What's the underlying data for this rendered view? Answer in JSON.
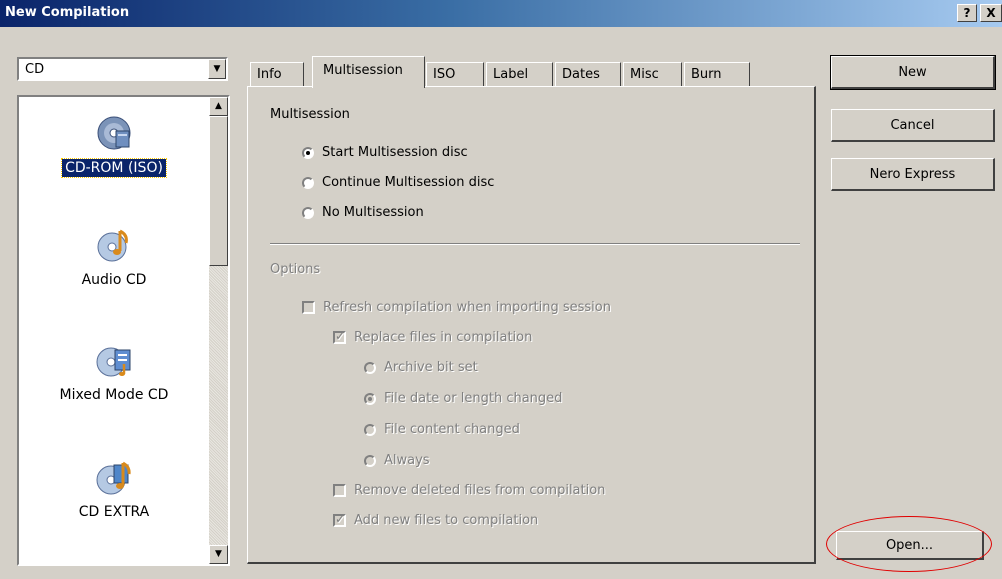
{
  "window": {
    "title": "New Compilation",
    "help_label": "?",
    "close_label": "X"
  },
  "disc_type": {
    "value": "CD"
  },
  "compilation_types": [
    {
      "label": "CD-ROM (ISO)",
      "icon": "cd-rom-iso-icon",
      "selected": true
    },
    {
      "label": "Audio CD",
      "icon": "audio-cd-icon",
      "selected": false
    },
    {
      "label": "Mixed Mode CD",
      "icon": "mixed-mode-cd-icon",
      "selected": false
    },
    {
      "label": "CD EXTRA",
      "icon": "cd-extra-icon",
      "selected": false
    }
  ],
  "tabs": [
    {
      "label": "Info",
      "active": false
    },
    {
      "label": "Multisession",
      "active": true
    },
    {
      "label": "ISO",
      "active": false
    },
    {
      "label": "Label",
      "active": false
    },
    {
      "label": "Dates",
      "active": false
    },
    {
      "label": "Misc",
      "active": false
    },
    {
      "label": "Burn",
      "active": false
    }
  ],
  "multisession": {
    "heading": "Multisession",
    "options": [
      {
        "label": "Start Multisession disc",
        "checked": true
      },
      {
        "label": "Continue Multisession disc",
        "checked": false
      },
      {
        "label": "No Multisession",
        "checked": false
      }
    ]
  },
  "options": {
    "heading": "Options",
    "refresh": {
      "label": "Refresh compilation when importing session",
      "checked": false
    },
    "replace": {
      "label": "Replace files in compilation",
      "checked": true
    },
    "replace_modes": [
      {
        "label": "Archive bit set",
        "checked": false
      },
      {
        "label": "File date or length changed",
        "checked": true
      },
      {
        "label": "File content changed",
        "checked": false
      },
      {
        "label": "Always",
        "checked": false
      }
    ],
    "remove_deleted": {
      "label": "Remove deleted files from compilation",
      "checked": false
    },
    "add_new": {
      "label": "Add new files to compilation",
      "checked": true
    }
  },
  "buttons": {
    "new": "New",
    "cancel": "Cancel",
    "nero_express": "Nero Express",
    "open": "Open..."
  },
  "colors": {
    "face": "#d4d0c8",
    "title_start": "#0a246a",
    "selection": "#0a246a",
    "annotation": "#e00000"
  }
}
